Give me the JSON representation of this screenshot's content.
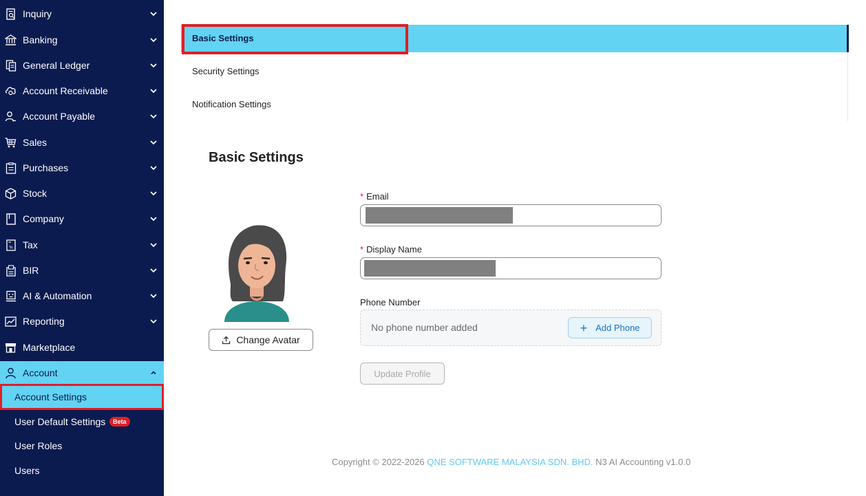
{
  "colors": {
    "sidebar_bg": "#0b1b4f",
    "accent": "#63d3f3",
    "highlight": "#e01f26",
    "link": "#63c8ee",
    "add_phone": "#1a73c9"
  },
  "sidebar": {
    "items": [
      {
        "label": "Inquiry",
        "icon": "inquiry-icon"
      },
      {
        "label": "Banking",
        "icon": "bank-icon"
      },
      {
        "label": "General Ledger",
        "icon": "ledger-icon"
      },
      {
        "label": "Account Receivable",
        "icon": "receivable-icon"
      },
      {
        "label": "Account Payable",
        "icon": "payable-icon"
      },
      {
        "label": "Sales",
        "icon": "cart-icon"
      },
      {
        "label": "Purchases",
        "icon": "purchases-icon"
      },
      {
        "label": "Stock",
        "icon": "box-icon"
      },
      {
        "label": "Company",
        "icon": "company-icon"
      },
      {
        "label": "Tax",
        "icon": "tax-icon"
      },
      {
        "label": "BIR",
        "icon": "bir-icon"
      },
      {
        "label": "AI & Automation",
        "icon": "ai-icon"
      },
      {
        "label": "Reporting",
        "icon": "chart-icon"
      },
      {
        "label": "Marketplace",
        "icon": "store-icon"
      },
      {
        "label": "Account",
        "icon": "user-icon"
      }
    ],
    "sub_items": [
      {
        "label": "Account Settings"
      },
      {
        "label": "User Default Settings",
        "badge": "Beta"
      },
      {
        "label": "User Roles"
      },
      {
        "label": "Users"
      }
    ]
  },
  "tabs": [
    {
      "label": "Basic Settings"
    },
    {
      "label": "Security Settings"
    },
    {
      "label": "Notification Settings"
    }
  ],
  "main": {
    "title": "Basic Settings",
    "change_avatar_label": "Change Avatar",
    "email": {
      "label": "Email",
      "required": "*"
    },
    "display_name": {
      "label": "Display Name",
      "required": "*"
    },
    "phone": {
      "label": "Phone Number",
      "empty_text": "No phone number added",
      "add_label": "Add Phone",
      "add_icon": "plus-icon"
    },
    "update_label": "Update Profile"
  },
  "footer": {
    "prefix": "Copyright",
    "years": " 2022-2026 ",
    "company": "QNE SOFTWARE MALAYSIA SDN. BHD.",
    "suffix": " N3 AI Accounting v1.0.0"
  }
}
